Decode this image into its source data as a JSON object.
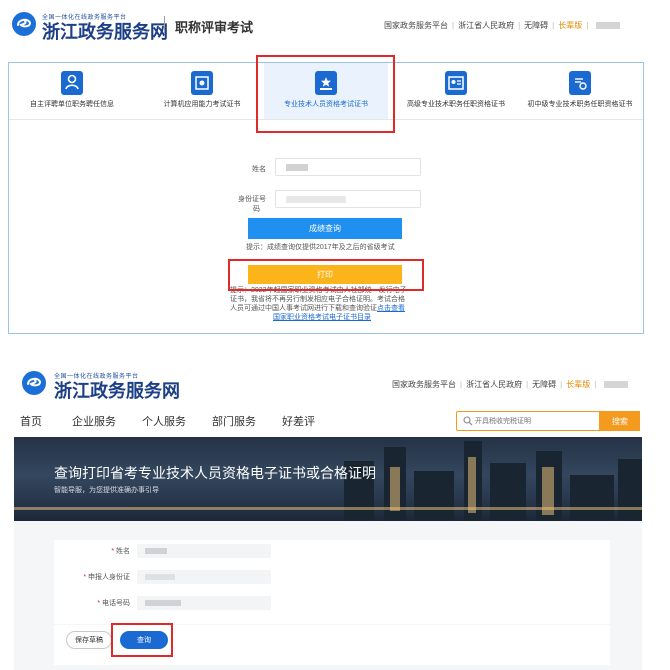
{
  "shot1": {
    "brand": {
      "small_text": "全国一体化在线政务服务平台",
      "name": "浙江政务服务网"
    },
    "subtitle": "职称评审考试",
    "top_links": [
      "国家政务服务平台",
      "浙江省人民政府",
      "无障碍",
      "长辈版"
    ],
    "categories": [
      {
        "label": "自主评聘单位职务聘任信息",
        "icon": "person-id-icon"
      },
      {
        "label": "计算机应用能力考试证书",
        "icon": "certificate-icon"
      },
      {
        "label": "专业技术人员资格考试证书",
        "icon": "star-card-icon"
      },
      {
        "label": "高级专业技术职务任职资格证书",
        "icon": "id-card-icon"
      },
      {
        "label": "初中级专业技术职务任职资格证书",
        "icon": "badge-document-icon"
      }
    ],
    "form": {
      "name_label": "姓名",
      "id_label_line1": "身份证号",
      "id_label_line2": "码",
      "query_button": "成绩查询",
      "query_hint": "提示：成绩查询仅提供2017年及之后的省级考试",
      "print_button": "打印",
      "tip_line1": "提示：2022年起国家职业资格考试由人社部统一发行电子",
      "tip_line2": "证书，我省将不再另行制发相应电子合格证明。考试合格",
      "tip_line3_text": "人员可通过中国人事考试网进行下载和查询验证",
      "tip_line3_link": "点击查看",
      "tip_line4_link": "国家职业资格考试电子证书目录"
    }
  },
  "shot2": {
    "brand": {
      "small_text": "全国一体化在线政务服务平台",
      "name": "浙江政务服务网"
    },
    "top_links": [
      "国家政务服务平台",
      "浙江省人民政府",
      "无障碍",
      "长辈版"
    ],
    "nav": [
      "首页",
      "企业服务",
      "个人服务",
      "部门服务",
      "好差评"
    ],
    "search": {
      "placeholder": "开具税收完税证明",
      "button": "搜索"
    },
    "banner": {
      "title": "查询打印省考专业技术人员资格电子证书或合格证明",
      "subtitle": "智能导服，为您提供准确办事引导"
    },
    "form": {
      "required_mark": "*",
      "name_label": "姓名",
      "id_label": "申报人身份证",
      "phone_label": "电话号码",
      "save_button": "保存草稿",
      "query_button": "查询"
    }
  },
  "colors": {
    "brand_blue": "#1b6ad1",
    "query_blue": "#1f8ff0",
    "print_yellow": "#fbb51a",
    "search_orange": "#f39a1f",
    "highlight_red": "#e02a2a"
  }
}
